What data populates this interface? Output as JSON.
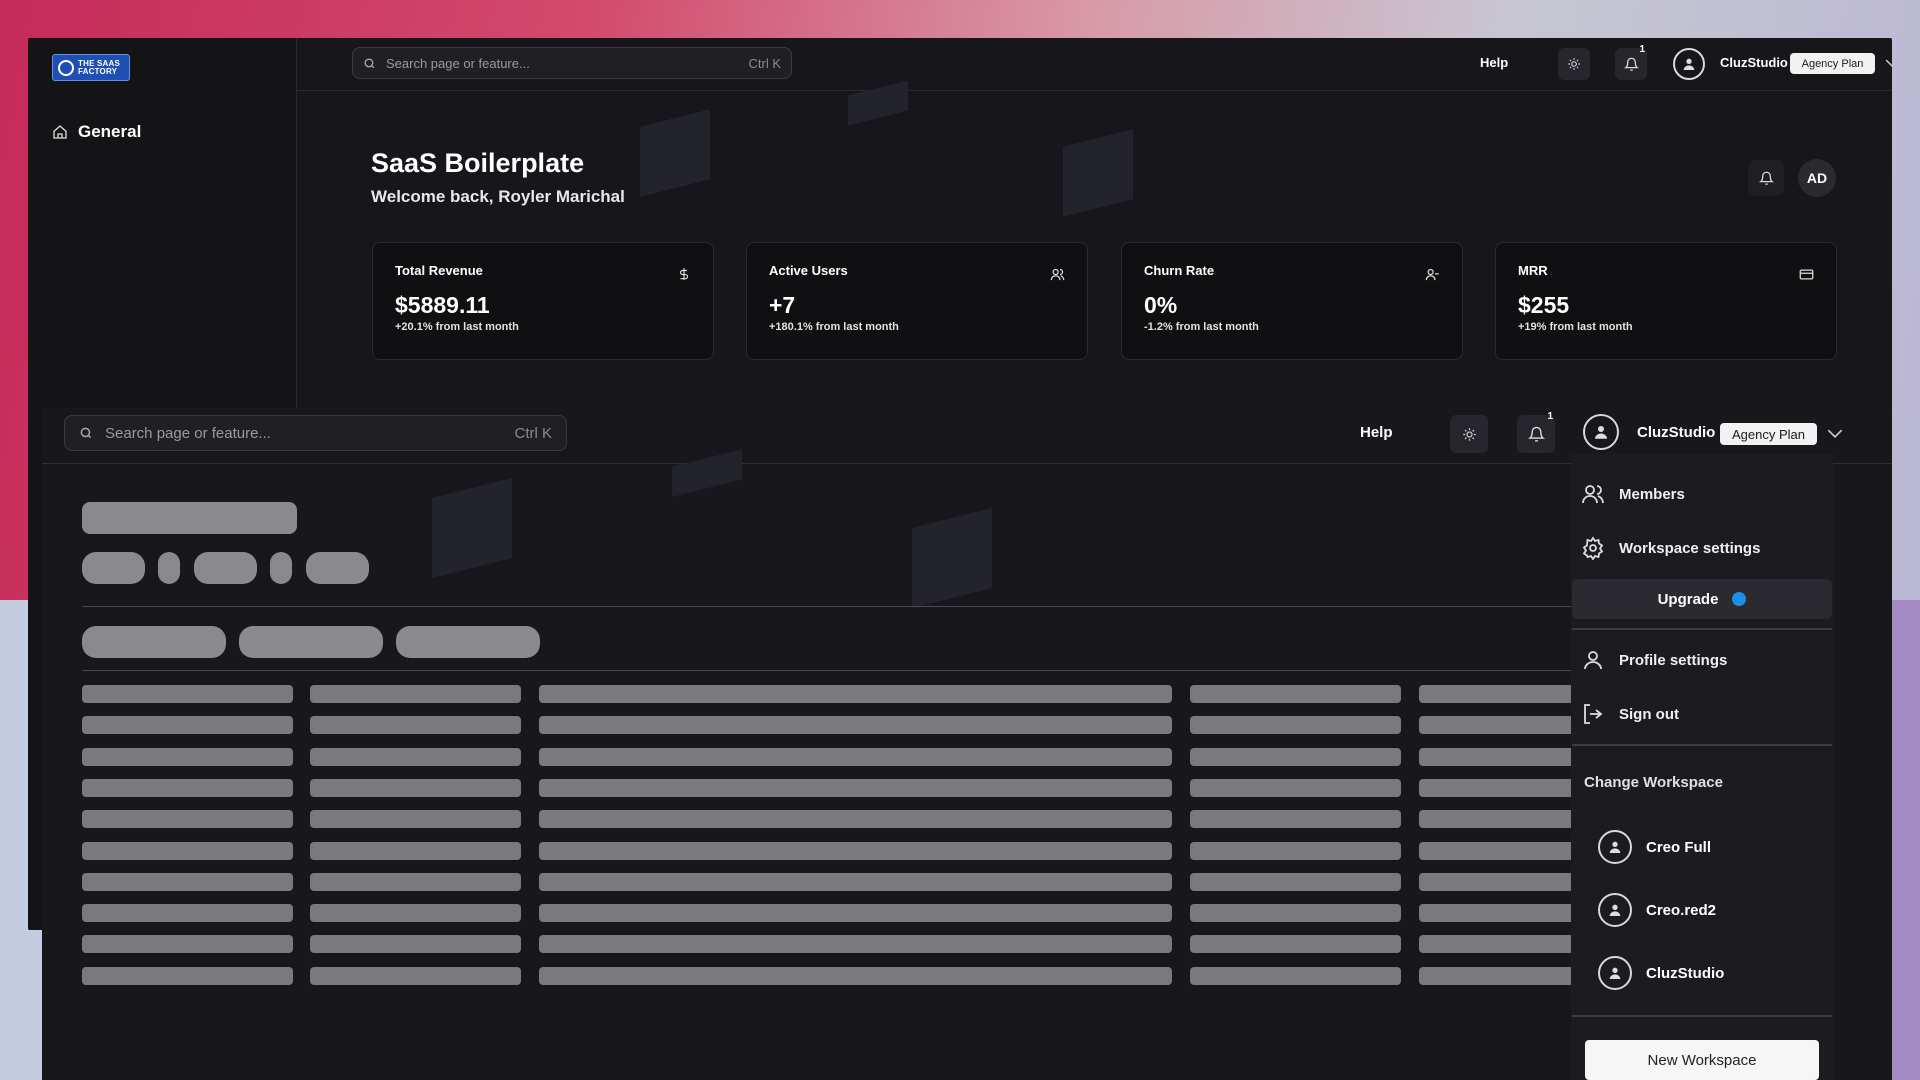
{
  "brand": {
    "logo_text": "THE SAAS FACTORY"
  },
  "sidebar": {
    "items": [
      {
        "label": "General",
        "icon": "home-icon"
      }
    ]
  },
  "header": {
    "search_placeholder": "Search page or feature...",
    "search_shortcut": "Ctrl K",
    "help_label": "Help",
    "notification_count": "1",
    "workspace_name": "CluzStudio",
    "plan_label": "Agency Plan"
  },
  "page": {
    "title": "SaaS Boilerplate",
    "subtitle": "Welcome back, Royler Marichal",
    "avatar_initials": "AD"
  },
  "cards": [
    {
      "title": "Total Revenue",
      "value": "$5889.11",
      "change": "+20.1% from last month",
      "icon": "dollar-icon"
    },
    {
      "title": "Active Users",
      "value": "+7",
      "change": "+180.1% from last month",
      "icon": "users-icon"
    },
    {
      "title": "Churn Rate",
      "value": "0%",
      "change": "-1.2% from last month",
      "icon": "user-minus-icon"
    },
    {
      "title": "MRR",
      "value": "$255",
      "change": "+19% from last month",
      "icon": "credit-card-icon"
    }
  ],
  "dropdown": {
    "members_label": "Members",
    "workspace_settings_label": "Workspace settings",
    "upgrade_label": "Upgrade",
    "profile_settings_label": "Profile settings",
    "sign_out_label": "Sign out",
    "change_workspace_label": "Change Workspace",
    "workspaces": [
      {
        "name": "Creo Full"
      },
      {
        "name": "Creo.red2"
      },
      {
        "name": "CluzStudio"
      }
    ],
    "new_workspace_label": "New Workspace"
  },
  "colors": {
    "accent": "#1e8fe8",
    "logo_blue": "#1f4fb5",
    "panel": "#17171b"
  }
}
